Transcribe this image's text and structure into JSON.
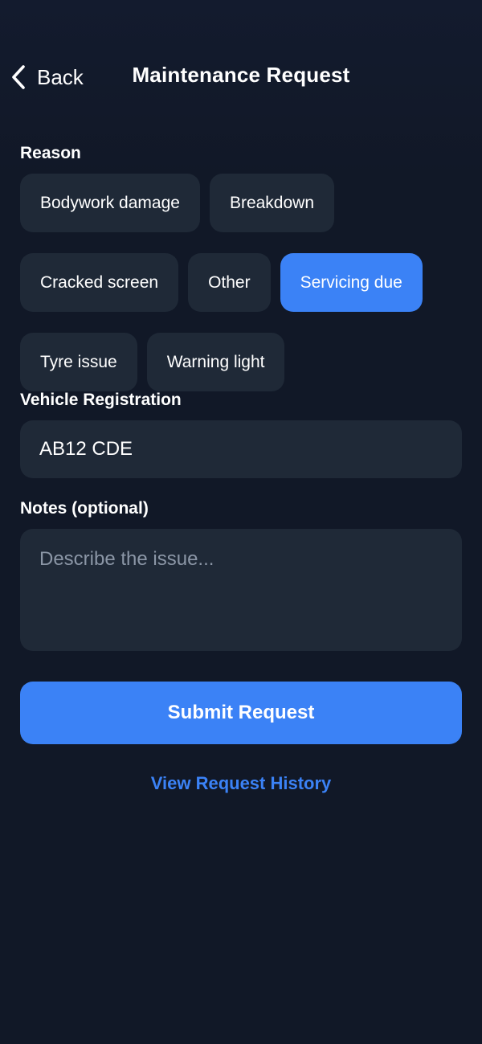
{
  "header": {
    "back_label": "Back",
    "back_icon": "chevron-left-icon",
    "title": "Maintenance Request"
  },
  "reason": {
    "label": "Reason",
    "options": [
      {
        "label": "Bodywork damage",
        "selected": false
      },
      {
        "label": "Breakdown",
        "selected": false
      },
      {
        "label": "Cracked screen",
        "selected": false
      },
      {
        "label": "Other",
        "selected": false
      },
      {
        "label": "Servicing due",
        "selected": true
      },
      {
        "label": "Tyre issue",
        "selected": false
      },
      {
        "label": "Warning light",
        "selected": false
      }
    ]
  },
  "vehicle": {
    "label": "Vehicle Registration",
    "value": "AB12 CDE"
  },
  "notes": {
    "label": "Notes (optional)",
    "value": "",
    "placeholder": "Describe the issue..."
  },
  "actions": {
    "submit_label": "Submit Request",
    "history_link": "View Request History"
  },
  "colors": {
    "background": "#111827",
    "surface": "#1f2937",
    "accent": "#3b82f6",
    "text": "#ffffff",
    "placeholder": "#8b96a6"
  }
}
